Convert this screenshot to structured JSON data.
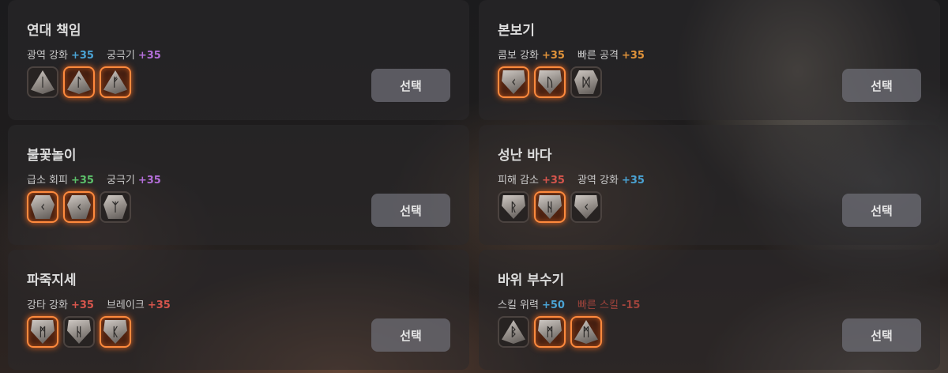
{
  "select_label": "선택",
  "colors": {
    "blue": "#4aa3d4",
    "purple": "#b36ed8",
    "orange": "#e0933a",
    "green": "#5cc06a",
    "red": "#d6554c",
    "dim_red": "#a0443c"
  },
  "cards": [
    {
      "title": "연대 책임",
      "stats": [
        {
          "label": "광역 강화",
          "value": "+35",
          "color": "blue"
        },
        {
          "label": "궁극기",
          "value": "+35",
          "color": "purple"
        }
      ],
      "runes": [
        {
          "glyph": "ᛁ",
          "shape": "pyramid",
          "glow": false
        },
        {
          "glyph": "ᛚ",
          "shape": "pyramid",
          "glow": true
        },
        {
          "glyph": "ᚠ",
          "shape": "pyramid",
          "glow": true
        }
      ]
    },
    {
      "title": "본보기",
      "stats": [
        {
          "label": "콤보 강화",
          "value": "+35",
          "color": "orange"
        },
        {
          "label": "빠른 공격",
          "value": "+35",
          "color": "orange"
        }
      ],
      "runes": [
        {
          "glyph": "ᚲ",
          "shape": "shield",
          "glow": true
        },
        {
          "glyph": "ᚢ",
          "shape": "shield",
          "glow": true
        },
        {
          "glyph": "ᛞ",
          "shape": "gem",
          "glow": false
        }
      ]
    },
    {
      "title": "불꽃놀이",
      "stats": [
        {
          "label": "급소 회피",
          "value": "+35",
          "color": "green"
        },
        {
          "label": "궁극기",
          "value": "+35",
          "color": "purple"
        }
      ],
      "runes": [
        {
          "glyph": "ᚲ",
          "shape": "gem",
          "glow": true
        },
        {
          "glyph": "ᚲ",
          "shape": "gem",
          "glow": true
        },
        {
          "glyph": "ᛉ",
          "shape": "gem",
          "glow": false
        }
      ]
    },
    {
      "title": "성난 바다",
      "stats": [
        {
          "label": "피해 감소",
          "value": "+35",
          "color": "red"
        },
        {
          "label": "광역 강화",
          "value": "+35",
          "color": "blue"
        }
      ],
      "runes": [
        {
          "glyph": "ᚱ",
          "shape": "shield",
          "glow": false
        },
        {
          "glyph": "ᚺ",
          "shape": "shield",
          "glow": true
        },
        {
          "glyph": "ᚲ",
          "shape": "shield",
          "glow": false
        }
      ]
    },
    {
      "title": "파죽지세",
      "stats": [
        {
          "label": "강타 강화",
          "value": "+35",
          "color": "red"
        },
        {
          "label": "브레이크",
          "value": "+35",
          "color": "red"
        }
      ],
      "runes": [
        {
          "glyph": "ᛗ",
          "shape": "shield",
          "glow": true
        },
        {
          "glyph": "ᚺ",
          "shape": "shield",
          "glow": false
        },
        {
          "glyph": "ᛕ",
          "shape": "shield",
          "glow": true
        }
      ]
    },
    {
      "title": "바위 부수기",
      "stats": [
        {
          "label": "스킬 위력",
          "value": "+50",
          "color": "blue"
        },
        {
          "label": "빠른 스킬",
          "value": "-15",
          "color": "dim_red",
          "label_color": "dim_red"
        }
      ],
      "runes": [
        {
          "glyph": "ᛒ",
          "shape": "pyramid",
          "glow": false
        },
        {
          "glyph": "ᛗ",
          "shape": "shield",
          "glow": true
        },
        {
          "glyph": "ᛗ",
          "shape": "pyramid",
          "glow": true
        }
      ]
    }
  ]
}
